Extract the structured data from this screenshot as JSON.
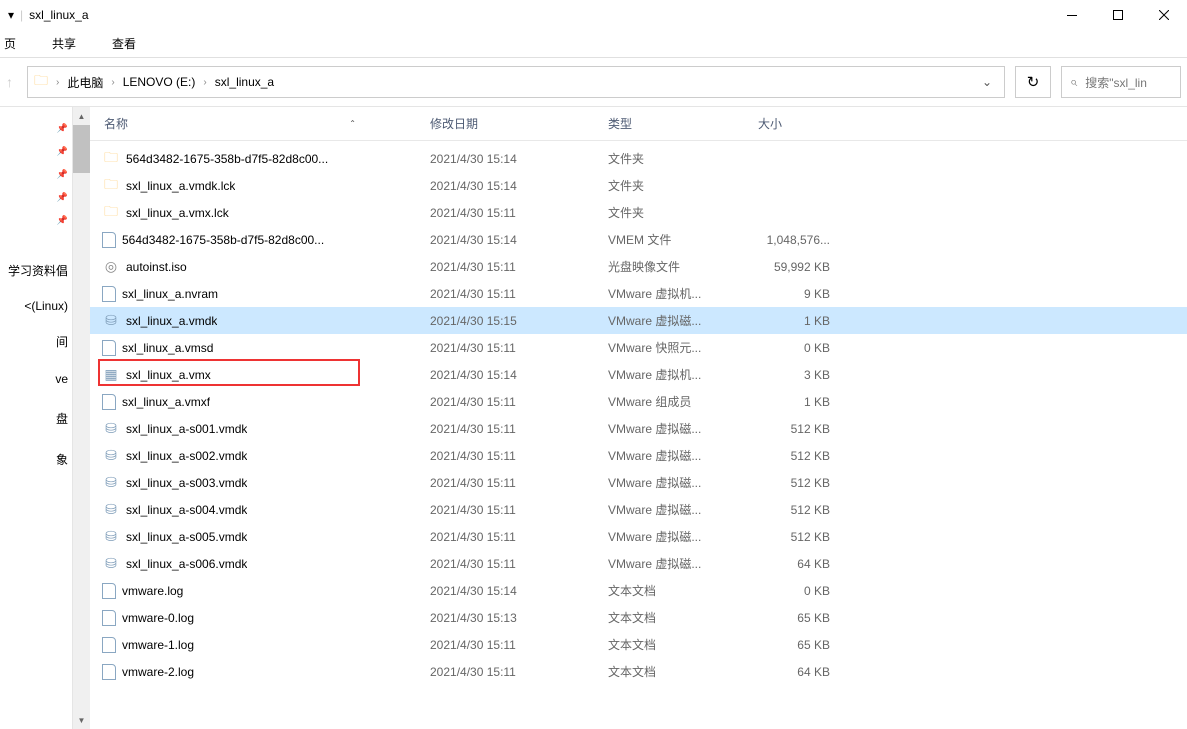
{
  "title": "sxl_linux_a",
  "ribbon_tabs": [
    "页",
    "共享",
    "查看"
  ],
  "breadcrumbs": [
    "此电脑",
    "LENOVO (E:)",
    "sxl_linux_a"
  ],
  "search_placeholder": "搜索\"sxl_lin",
  "quick_access": [
    {
      "label": "",
      "pinned": true
    },
    {
      "label": "",
      "pinned": true
    },
    {
      "label": "",
      "pinned": true
    },
    {
      "label": "",
      "pinned": true
    },
    {
      "label": "",
      "pinned": true
    },
    {
      "label": "",
      "pinned": false
    },
    {
      "label": "学习资料倡",
      "pinned": false
    },
    {
      "label": "<(Linux)",
      "pinned": false
    },
    {
      "label": "间",
      "pinned": false
    },
    {
      "label": "ve",
      "pinned": false
    },
    {
      "label": "盘",
      "pinned": false
    },
    {
      "label": "象",
      "pinned": false
    }
  ],
  "columns": {
    "name": "名称",
    "date": "修改日期",
    "type": "类型",
    "size": "大小"
  },
  "files": [
    {
      "icon": "folder",
      "name": "564d3482-1675-358b-d7f5-82d8c00...",
      "date": "2021/4/30 15:14",
      "type": "文件夹",
      "size": ""
    },
    {
      "icon": "folder",
      "name": "sxl_linux_a.vmdk.lck",
      "date": "2021/4/30 15:14",
      "type": "文件夹",
      "size": ""
    },
    {
      "icon": "folder",
      "name": "sxl_linux_a.vmx.lck",
      "date": "2021/4/30 15:11",
      "type": "文件夹",
      "size": ""
    },
    {
      "icon": "file",
      "name": "564d3482-1675-358b-d7f5-82d8c00...",
      "date": "2021/4/30 15:14",
      "type": "VMEM 文件",
      "size": "1,048,576..."
    },
    {
      "icon": "iso",
      "name": "autoinst.iso",
      "date": "2021/4/30 15:11",
      "type": "光盘映像文件",
      "size": "59,992 KB"
    },
    {
      "icon": "file",
      "name": "sxl_linux_a.nvram",
      "date": "2021/4/30 15:11",
      "type": "VMware 虚拟机...",
      "size": "9 KB"
    },
    {
      "icon": "vmdk",
      "name": "sxl_linux_a.vmdk",
      "date": "2021/4/30 15:15",
      "type": "VMware 虚拟磁...",
      "size": "1 KB",
      "selected": true
    },
    {
      "icon": "file",
      "name": "sxl_linux_a.vmsd",
      "date": "2021/4/30 15:11",
      "type": "VMware 快照元...",
      "size": "0 KB"
    },
    {
      "icon": "vmx",
      "name": "sxl_linux_a.vmx",
      "date": "2021/4/30 15:14",
      "type": "VMware 虚拟机...",
      "size": "3 KB",
      "highlight": true
    },
    {
      "icon": "file",
      "name": "sxl_linux_a.vmxf",
      "date": "2021/4/30 15:11",
      "type": "VMware 组成员",
      "size": "1 KB"
    },
    {
      "icon": "vmdk",
      "name": "sxl_linux_a-s001.vmdk",
      "date": "2021/4/30 15:11",
      "type": "VMware 虚拟磁...",
      "size": "512 KB"
    },
    {
      "icon": "vmdk",
      "name": "sxl_linux_a-s002.vmdk",
      "date": "2021/4/30 15:11",
      "type": "VMware 虚拟磁...",
      "size": "512 KB"
    },
    {
      "icon": "vmdk",
      "name": "sxl_linux_a-s003.vmdk",
      "date": "2021/4/30 15:11",
      "type": "VMware 虚拟磁...",
      "size": "512 KB"
    },
    {
      "icon": "vmdk",
      "name": "sxl_linux_a-s004.vmdk",
      "date": "2021/4/30 15:11",
      "type": "VMware 虚拟磁...",
      "size": "512 KB"
    },
    {
      "icon": "vmdk",
      "name": "sxl_linux_a-s005.vmdk",
      "date": "2021/4/30 15:11",
      "type": "VMware 虚拟磁...",
      "size": "512 KB"
    },
    {
      "icon": "vmdk",
      "name": "sxl_linux_a-s006.vmdk",
      "date": "2021/4/30 15:11",
      "type": "VMware 虚拟磁...",
      "size": "64 KB"
    },
    {
      "icon": "file",
      "name": "vmware.log",
      "date": "2021/4/30 15:14",
      "type": "文本文档",
      "size": "0 KB"
    },
    {
      "icon": "file",
      "name": "vmware-0.log",
      "date": "2021/4/30 15:13",
      "type": "文本文档",
      "size": "65 KB"
    },
    {
      "icon": "file",
      "name": "vmware-1.log",
      "date": "2021/4/30 15:11",
      "type": "文本文档",
      "size": "65 KB"
    },
    {
      "icon": "file",
      "name": "vmware-2.log",
      "date": "2021/4/30 15:11",
      "type": "文本文档",
      "size": "64 KB"
    }
  ]
}
